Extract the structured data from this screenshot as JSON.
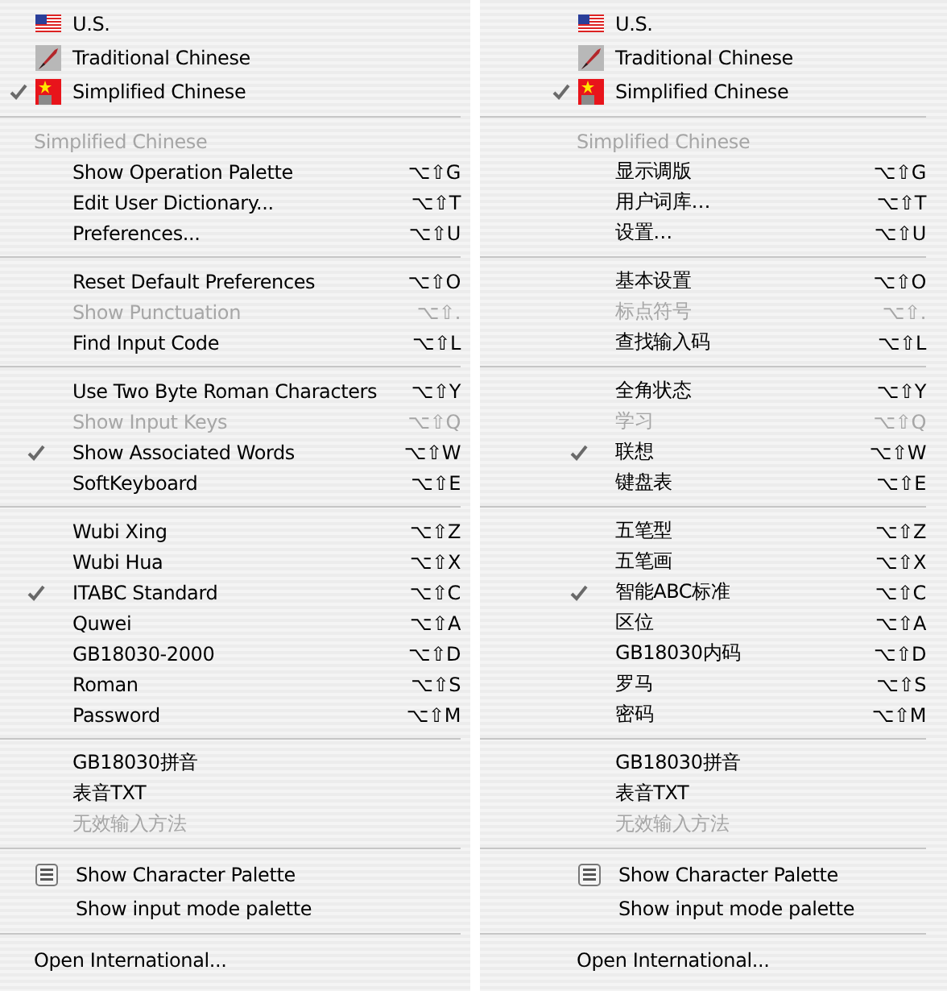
{
  "menus": [
    {
      "groups": [
        {
          "items": [
            {
              "kind": "language",
              "label": "U.S.",
              "checked": false
            },
            {
              "kind": "language",
              "label": "Traditional Chinese",
              "checked": false
            },
            {
              "kind": "language",
              "label": "Simplified Chinese",
              "checked": true
            }
          ]
        },
        {
          "items": [
            {
              "kind": "header",
              "label": "Simplified Chinese"
            },
            {
              "kind": "command",
              "label": "Show Operation Palette",
              "shortcut": "⌥⇧G",
              "checked": false,
              "disabled": false
            },
            {
              "kind": "command",
              "label": "Edit User Dictionary...",
              "shortcut": "⌥⇧T",
              "checked": false,
              "disabled": false
            },
            {
              "kind": "command",
              "label": "Preferences...",
              "shortcut": "⌥⇧U",
              "checked": false,
              "disabled": false
            }
          ]
        },
        {
          "items": [
            {
              "kind": "command",
              "label": "Reset Default Preferences",
              "shortcut": "⌥⇧O",
              "checked": false,
              "disabled": false
            },
            {
              "kind": "command",
              "label": "Show Punctuation",
              "shortcut": "⌥⇧.",
              "checked": false,
              "disabled": true
            },
            {
              "kind": "command",
              "label": "Find Input Code",
              "shortcut": "⌥⇧L",
              "checked": false,
              "disabled": false
            }
          ]
        },
        {
          "items": [
            {
              "kind": "command",
              "label": "Use Two Byte Roman Characters",
              "shortcut": "⌥⇧Y",
              "checked": false,
              "disabled": false
            },
            {
              "kind": "command",
              "label": "Show Input Keys",
              "shortcut": "⌥⇧Q",
              "checked": false,
              "disabled": true
            },
            {
              "kind": "command",
              "label": "Show Associated Words",
              "shortcut": "⌥⇧W",
              "checked": true,
              "disabled": false
            },
            {
              "kind": "command",
              "label": "SoftKeyboard",
              "shortcut": "⌥⇧E",
              "checked": false,
              "disabled": false
            }
          ]
        },
        {
          "items": [
            {
              "kind": "command",
              "label": "Wubi Xing",
              "shortcut": "⌥⇧Z",
              "checked": false,
              "disabled": false
            },
            {
              "kind": "command",
              "label": "Wubi Hua",
              "shortcut": "⌥⇧X",
              "checked": false,
              "disabled": false
            },
            {
              "kind": "command",
              "label": "ITABC Standard",
              "shortcut": "⌥⇧C",
              "checked": true,
              "disabled": false
            },
            {
              "kind": "command",
              "label": "Quwei",
              "shortcut": "⌥⇧A",
              "checked": false,
              "disabled": false
            },
            {
              "kind": "command",
              "label": "GB18030-2000",
              "shortcut": "⌥⇧D",
              "checked": false,
              "disabled": false
            },
            {
              "kind": "command",
              "label": "Roman",
              "shortcut": "⌥⇧S",
              "checked": false,
              "disabled": false
            },
            {
              "kind": "command",
              "label": "Password",
              "shortcut": "⌥⇧M",
              "checked": false,
              "disabled": false
            }
          ]
        },
        {
          "items": [
            {
              "kind": "command",
              "label": "GB18030拼音",
              "checked": false,
              "disabled": false
            },
            {
              "kind": "command",
              "label": "表音TXT",
              "checked": false,
              "disabled": false
            },
            {
              "kind": "command",
              "label": "无效输入方法",
              "checked": false,
              "disabled": true
            }
          ]
        },
        {
          "items": [
            {
              "kind": "palette",
              "label": "Show Character Palette"
            },
            {
              "kind": "tool",
              "label": "Show input mode palette"
            }
          ]
        },
        {
          "items": [
            {
              "kind": "international",
              "label": "Open International..."
            }
          ]
        }
      ]
    },
    {
      "groups": [
        {
          "items": [
            {
              "kind": "language",
              "label": "U.S.",
              "checked": false
            },
            {
              "kind": "language",
              "label": "Traditional Chinese",
              "checked": false
            },
            {
              "kind": "language",
              "label": "Simplified Chinese",
              "checked": true
            }
          ]
        },
        {
          "items": [
            {
              "kind": "header",
              "label": "Simplified Chinese"
            },
            {
              "kind": "command",
              "label": "显示调版",
              "shortcut": "⌥⇧G",
              "checked": false,
              "disabled": false
            },
            {
              "kind": "command",
              "label": "用户词库…",
              "shortcut": "⌥⇧T",
              "checked": false,
              "disabled": false
            },
            {
              "kind": "command",
              "label": "设置…",
              "shortcut": "⌥⇧U",
              "checked": false,
              "disabled": false
            }
          ]
        },
        {
          "items": [
            {
              "kind": "command",
              "label": "基本设置",
              "shortcut": "⌥⇧O",
              "checked": false,
              "disabled": false
            },
            {
              "kind": "command",
              "label": "标点符号",
              "shortcut": "⌥⇧.",
              "checked": false,
              "disabled": true
            },
            {
              "kind": "command",
              "label": "查找输入码",
              "shortcut": "⌥⇧L",
              "checked": false,
              "disabled": false
            }
          ]
        },
        {
          "items": [
            {
              "kind": "command",
              "label": "全角状态",
              "shortcut": "⌥⇧Y",
              "checked": false,
              "disabled": false
            },
            {
              "kind": "command",
              "label": "学习",
              "shortcut": "⌥⇧Q",
              "checked": false,
              "disabled": true
            },
            {
              "kind": "command",
              "label": "联想",
              "shortcut": "⌥⇧W",
              "checked": true,
              "disabled": false
            },
            {
              "kind": "command",
              "label": "键盘表",
              "shortcut": "⌥⇧E",
              "checked": false,
              "disabled": false
            }
          ]
        },
        {
          "items": [
            {
              "kind": "command",
              "label": "五笔型",
              "shortcut": "⌥⇧Z",
              "checked": false,
              "disabled": false
            },
            {
              "kind": "command",
              "label": "五笔画",
              "shortcut": "⌥⇧X",
              "checked": false,
              "disabled": false
            },
            {
              "kind": "command",
              "label": "智能ABC标准",
              "shortcut": "⌥⇧C",
              "checked": true,
              "disabled": false
            },
            {
              "kind": "command",
              "label": "区位",
              "shortcut": "⌥⇧A",
              "checked": false,
              "disabled": false
            },
            {
              "kind": "command",
              "label": "GB18030内码",
              "shortcut": "⌥⇧D",
              "checked": false,
              "disabled": false
            },
            {
              "kind": "command",
              "label": "罗马",
              "shortcut": "⌥⇧S",
              "checked": false,
              "disabled": false
            },
            {
              "kind": "command",
              "label": "密码",
              "shortcut": "⌥⇧M",
              "checked": false,
              "disabled": false
            }
          ]
        },
        {
          "items": [
            {
              "kind": "command",
              "label": "GB18030拼音",
              "checked": false,
              "disabled": false
            },
            {
              "kind": "command",
              "label": "表音TXT",
              "checked": false,
              "disabled": false
            },
            {
              "kind": "command",
              "label": "无效输入方法",
              "checked": false,
              "disabled": true
            }
          ]
        },
        {
          "items": [
            {
              "kind": "palette",
              "label": "Show Character Palette"
            },
            {
              "kind": "tool",
              "label": "Show input mode palette"
            }
          ]
        },
        {
          "items": [
            {
              "kind": "international",
              "label": "Open International..."
            }
          ]
        }
      ]
    }
  ]
}
